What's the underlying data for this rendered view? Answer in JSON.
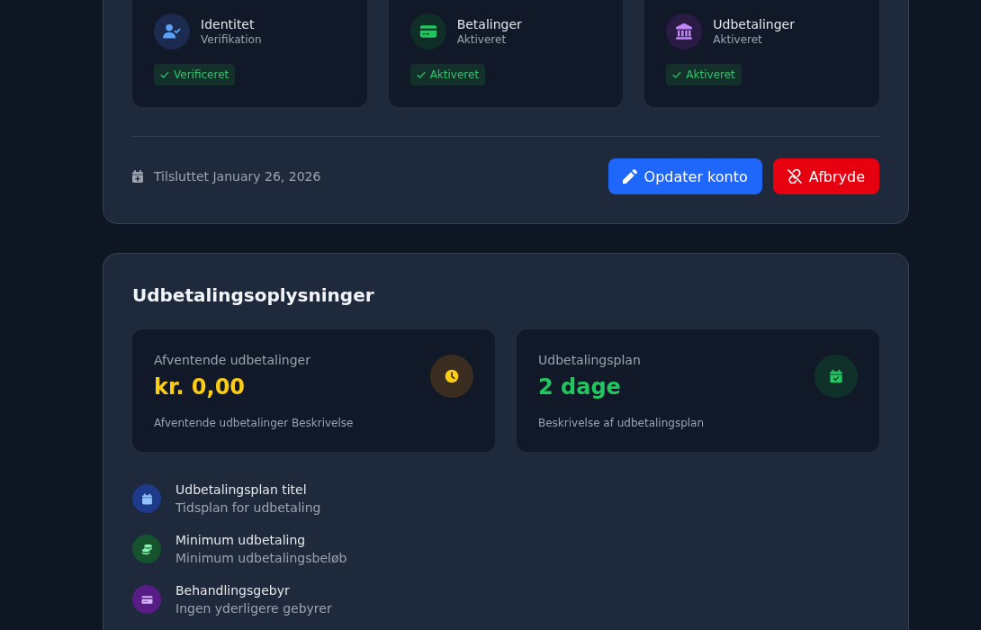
{
  "account": {
    "services": [
      {
        "kind": "identity",
        "title": "Identitet",
        "subtitle": "Verifikation",
        "status": "Verificeret"
      },
      {
        "kind": "payments",
        "title": "Betalinger",
        "subtitle": "Aktiveret",
        "status": "Aktiveret"
      },
      {
        "kind": "payouts",
        "title": "Udbetalinger",
        "subtitle": "Aktiveret",
        "status": "Aktiveret"
      }
    ],
    "connected": "Tilsluttet January 26, 2026",
    "actions": [
      {
        "kind": "update",
        "label": "Opdater konto"
      },
      {
        "kind": "disconnect",
        "label": "Afbryde"
      }
    ]
  },
  "payout_info": {
    "title": "Udbetalingsoplysninger",
    "stats": [
      {
        "kind": "pending",
        "label": "Afventende udbetalinger",
        "value": "kr. 0,00",
        "description": "Afventende udbetalinger Beskrivelse"
      },
      {
        "kind": "schedule",
        "label": "Udbetalingsplan",
        "value": "2 dage",
        "description": "Beskrivelse af udbetalingsplan"
      }
    ],
    "details": [
      {
        "kind": "schedule",
        "title": "Udbetalingsplan titel",
        "subtitle": "Tidsplan for udbetaling"
      },
      {
        "kind": "minimum",
        "title": "Minimum udbetaling",
        "subtitle": "Minimum udbetalingsbeløb"
      },
      {
        "kind": "fee",
        "title": "Behandlingsgebyr",
        "subtitle": "Ingen yderligere gebyrer"
      }
    ]
  }
}
